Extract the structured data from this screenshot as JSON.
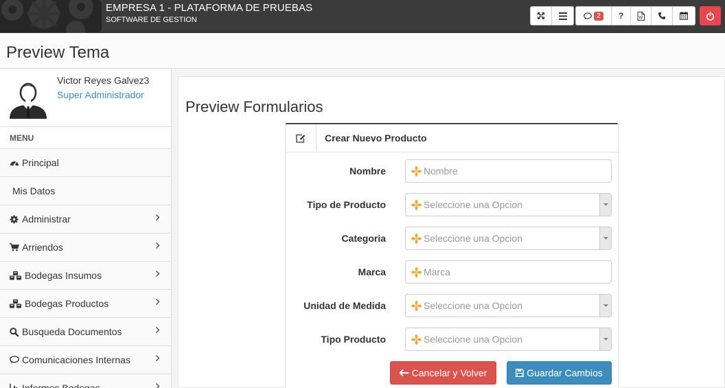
{
  "header": {
    "brand_title": "EMPRESA 1 - PLATAFORMA DE PRUEBAS",
    "brand_subtitle": "SOFTWARE DE GESTION",
    "messages_count": "2",
    "icons": [
      "fullscreen-icon",
      "list-icon",
      "comment-icon",
      "help-icon",
      "word-document-icon",
      "phone-icon",
      "calendar-icon",
      "power-icon"
    ]
  },
  "page": {
    "title": "Preview Tema"
  },
  "user": {
    "name": "Victor Reyes Galvez3",
    "role": "Super Administrador"
  },
  "sidebar": {
    "menu_label": "MENU",
    "items": [
      {
        "label": "Principal",
        "icon": "dashboard-icon",
        "has_chevron": false
      },
      {
        "label": "Mis Datos",
        "icon": "",
        "has_chevron": false
      },
      {
        "label": "Administrar",
        "icon": "gear-icon",
        "has_chevron": true
      },
      {
        "label": "Arriendos",
        "icon": "cart-icon",
        "has_chevron": true
      },
      {
        "label": "Bodegas Insumos",
        "icon": "cubes-icon",
        "has_chevron": true
      },
      {
        "label": "Bodegas Productos",
        "icon": "cubes-icon",
        "has_chevron": true
      },
      {
        "label": "Busqueda Documentos",
        "icon": "search-icon",
        "has_chevron": true
      },
      {
        "label": "Comunicaciones Internas",
        "icon": "comment-icon",
        "has_chevron": true
      },
      {
        "label": "Informes Bodegas",
        "icon": "chart-icon",
        "has_chevron": true
      }
    ]
  },
  "main": {
    "title": "Preview Formularios",
    "card_title": "Crear Nuevo Producto",
    "fields": [
      {
        "label": "Nombre",
        "type": "input",
        "placeholder": "Nombre"
      },
      {
        "label": "Tipo de Producto",
        "type": "select",
        "placeholder": "Seleccione una Opcion"
      },
      {
        "label": "Categoria",
        "type": "select",
        "placeholder": "Seleccione una Opcion"
      },
      {
        "label": "Marca",
        "type": "input",
        "placeholder": "Marca"
      },
      {
        "label": "Unidad de Medida",
        "type": "select",
        "placeholder": "Seleccione una Opcion"
      },
      {
        "label": "Tipo Producto",
        "type": "select",
        "placeholder": "Seleccione una Opcion"
      }
    ],
    "cancel_label": "Cancelar y Volver",
    "save_label": "Guardar Cambios"
  },
  "colors": {
    "topbar": "#3b3b3b",
    "danger": "#d9534f",
    "primary": "#3c8dbc",
    "power": "#e8454f",
    "link": "#3c8dbc"
  }
}
